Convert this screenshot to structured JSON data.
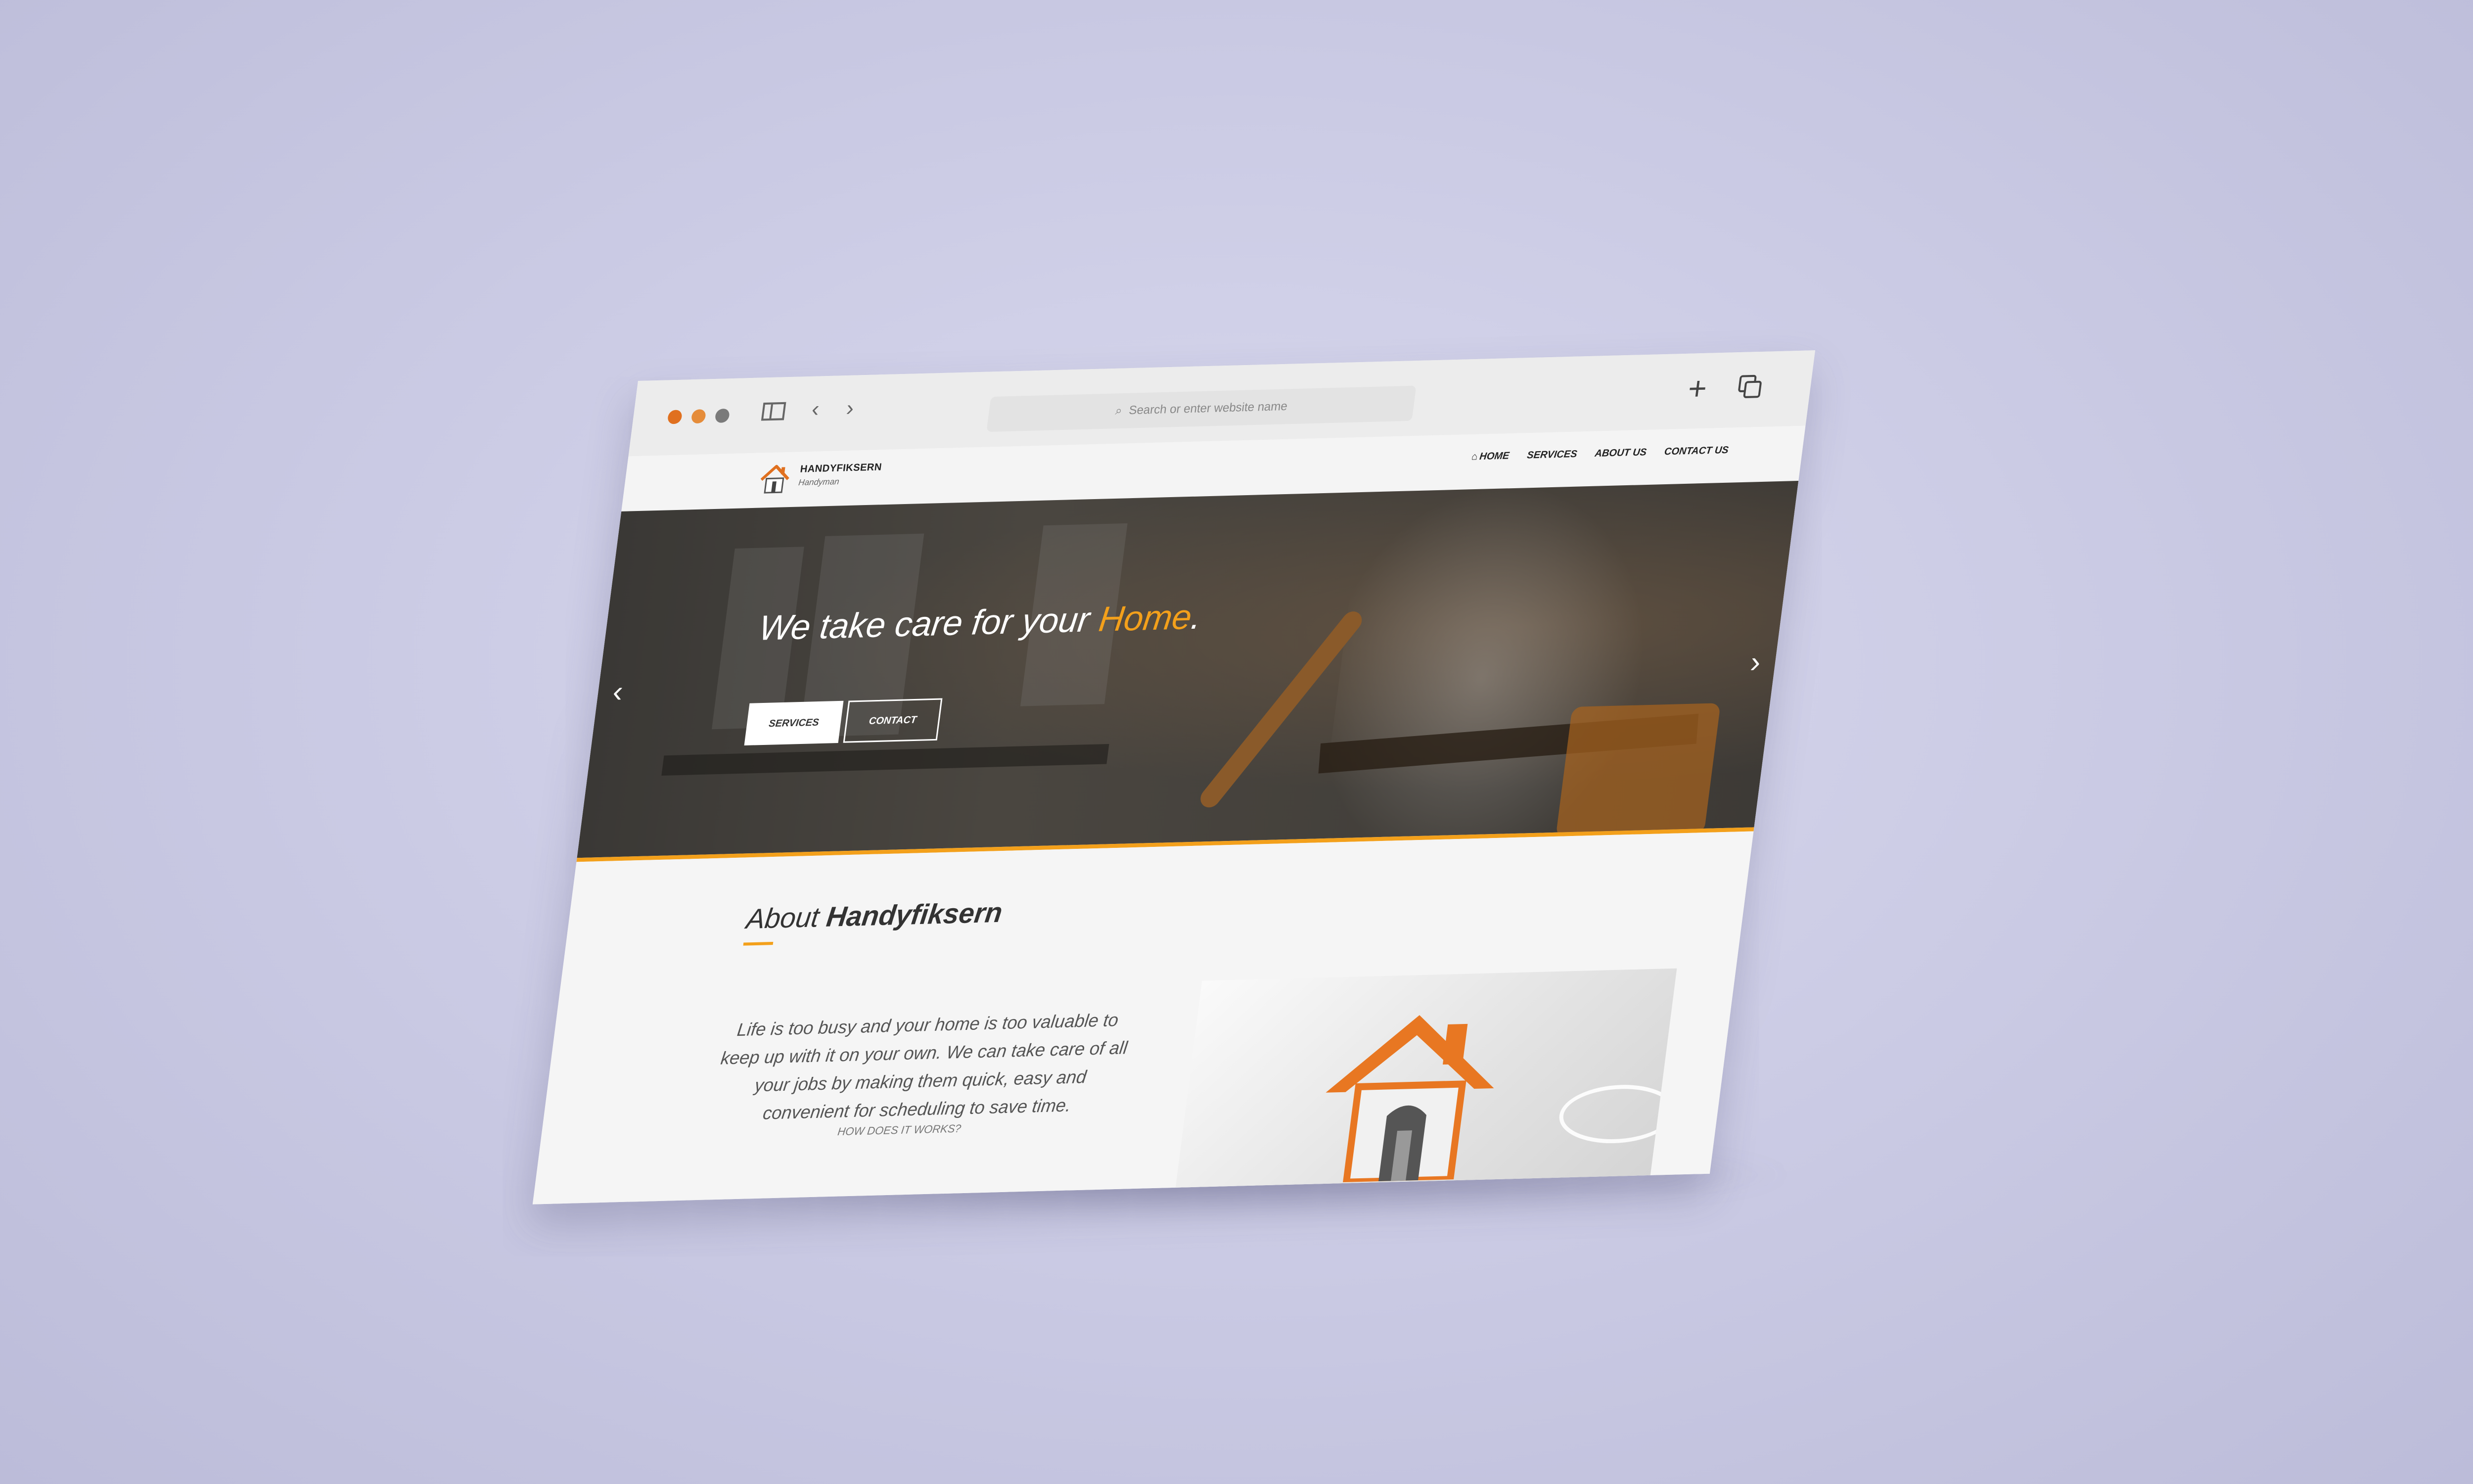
{
  "browser": {
    "address_placeholder": "Search or enter website name"
  },
  "site": {
    "brand_name": "HANDYFIKSERN",
    "brand_tagline": "Handyman",
    "nav": {
      "home": "HOME",
      "services": "SERVICES",
      "about": "ABOUT US",
      "contact": "CONTACT US"
    }
  },
  "hero": {
    "title_prefix": "We take care for your ",
    "title_accent": "Home",
    "title_suffix": ".",
    "buttons": {
      "services": "SERVICES",
      "contact": "CONTACT"
    }
  },
  "about": {
    "heading_light": "About ",
    "heading_bold": "Handyfiksern",
    "body": "Life is too busy and your home is too valuable to keep up with it on your own. We can take care of all your jobs by making them quick, easy and convenient for scheduling to save time.",
    "link": "HOW DOES IT WORKS?"
  },
  "colors": {
    "accent": "#f3a01b",
    "brand_orange": "#e0701f"
  },
  "icons": {
    "left_arrow": "chevron-left-icon",
    "right_arrow": "chevron-right-icon",
    "home": "home-icon"
  }
}
